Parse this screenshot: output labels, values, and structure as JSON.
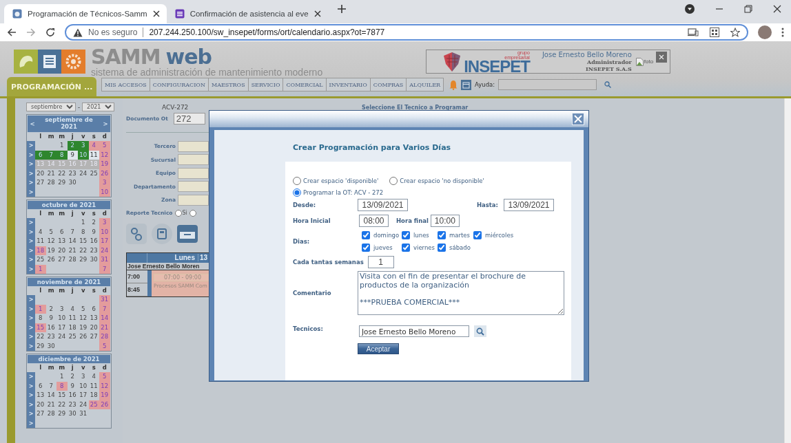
{
  "browser": {
    "tabs": [
      {
        "title": "Programación de Técnicos-Samm",
        "selected": true
      },
      {
        "title": "Confirmación de asistencia al eve",
        "selected": false
      }
    ],
    "security": "No es seguro",
    "url": "207.244.250.100/sw_insepet/forms/ort/calendario.aspx?ot=7877"
  },
  "header": {
    "brand_main": "SAMM",
    "brand_accent": "web",
    "tagline": "sistema de administración de mantenimiento moderno",
    "section_tab": "PROGRAMACIÓN ...",
    "menu": [
      "MIS ACCESOS",
      "CONFIGURACION",
      "MAESTROS",
      "SERVICIO",
      "COMERCIAL",
      "INVENTARIO",
      "COMPRAS",
      "ALQUILER"
    ],
    "help_label": "Ayuda:",
    "company": {
      "group_top": "grupo",
      "group_bottom": "empresarial",
      "name": "INSEPET"
    },
    "user": {
      "name": "Jose Ernesto Bello Moreno",
      "role": "Administrador",
      "company": "INSEPET S.A.S",
      "photo_alt": "foto"
    }
  },
  "calendar_panel": {
    "month_select": "septiembre",
    "separator": "-",
    "year_select": "2021",
    "months": [
      {
        "title": "septiembre de 2021",
        "prev": "<",
        "next": ">",
        "weekdays": [
          "l",
          "m",
          "m",
          "j",
          "v",
          "s",
          "d"
        ],
        "weeks": [
          {
            "arrow": ">",
            "days": [
              {
                "kind": "blank"
              },
              {
                "kind": "blank"
              },
              {
                "d": "1",
                "kind": "plain"
              },
              {
                "d": "2",
                "kind": "scheduled"
              },
              {
                "d": "3",
                "kind": "scheduled"
              },
              {
                "d": "4",
                "kind": "holiday"
              },
              {
                "d": "5",
                "kind": "holiday"
              }
            ]
          },
          {
            "arrow": ">",
            "days": [
              {
                "d": "6",
                "kind": "scheduled"
              },
              {
                "d": "7",
                "kind": "scheduled"
              },
              {
                "d": "8",
                "kind": "scheduled"
              },
              {
                "d": "9",
                "kind": "light"
              },
              {
                "d": "10",
                "kind": "scheduled"
              },
              {
                "d": "11",
                "kind": "light"
              },
              {
                "d": "12",
                "kind": "holiday"
              }
            ]
          },
          {
            "arrow": ">",
            "days": [
              {
                "d": "13",
                "kind": "week"
              },
              {
                "d": "14",
                "kind": "week"
              },
              {
                "d": "15",
                "kind": "week"
              },
              {
                "d": "16",
                "kind": "week"
              },
              {
                "d": "17",
                "kind": "week"
              },
              {
                "d": "18",
                "kind": "week"
              },
              {
                "d": "19",
                "kind": "holiday"
              }
            ]
          },
          {
            "arrow": ">",
            "days": [
              {
                "d": "20",
                "kind": "plain"
              },
              {
                "d": "21",
                "kind": "plain"
              },
              {
                "d": "22",
                "kind": "plain"
              },
              {
                "d": "23",
                "kind": "plain"
              },
              {
                "d": "24",
                "kind": "plain"
              },
              {
                "d": "25",
                "kind": "plain"
              },
              {
                "d": "26",
                "kind": "holiday"
              }
            ]
          },
          {
            "arrow": ">",
            "days": [
              {
                "d": "27",
                "kind": "plain"
              },
              {
                "d": "28",
                "kind": "plain"
              },
              {
                "d": "29",
                "kind": "plain"
              },
              {
                "d": "30",
                "kind": "plain"
              },
              {
                "kind": "blank"
              },
              {
                "kind": "blank"
              },
              {
                "d": "3",
                "kind": "holiday"
              }
            ]
          },
          {
            "arrow": ">",
            "days": [
              {
                "kind": "blank"
              },
              {
                "kind": "blank"
              },
              {
                "kind": "blank"
              },
              {
                "kind": "blank"
              },
              {
                "kind": "blank"
              },
              {
                "kind": "blank"
              },
              {
                "d": "10",
                "kind": "holiday"
              }
            ]
          }
        ]
      },
      {
        "title": "octubre de 2021",
        "weekdays": [
          "l",
          "m",
          "m",
          "j",
          "v",
          "s",
          "d"
        ],
        "weeks": [
          {
            "arrow": ">",
            "days": [
              {
                "kind": "blank"
              },
              {
                "kind": "blank"
              },
              {
                "kind": "blank"
              },
              {
                "kind": "blank"
              },
              {
                "d": "1",
                "kind": "plain"
              },
              {
                "d": "2",
                "kind": "plain"
              },
              {
                "d": "3",
                "kind": "holiday"
              }
            ]
          },
          {
            "arrow": ">",
            "days": [
              {
                "d": "4",
                "kind": "plain"
              },
              {
                "d": "5",
                "kind": "plain"
              },
              {
                "d": "6",
                "kind": "plain"
              },
              {
                "d": "7",
                "kind": "plain"
              },
              {
                "d": "8",
                "kind": "plain"
              },
              {
                "d": "9",
                "kind": "plain"
              },
              {
                "d": "10",
                "kind": "holiday"
              }
            ]
          },
          {
            "arrow": ">",
            "days": [
              {
                "d": "11",
                "kind": "plain"
              },
              {
                "d": "12",
                "kind": "plain"
              },
              {
                "d": "13",
                "kind": "plain"
              },
              {
                "d": "14",
                "kind": "plain"
              },
              {
                "d": "15",
                "kind": "plain"
              },
              {
                "d": "16",
                "kind": "plain"
              },
              {
                "d": "17",
                "kind": "holiday"
              }
            ]
          },
          {
            "arrow": ">",
            "days": [
              {
                "d": "18",
                "kind": "holiday"
              },
              {
                "d": "19",
                "kind": "plain"
              },
              {
                "d": "20",
                "kind": "plain"
              },
              {
                "d": "21",
                "kind": "plain"
              },
              {
                "d": "22",
                "kind": "plain"
              },
              {
                "d": "23",
                "kind": "plain"
              },
              {
                "d": "24",
                "kind": "holiday"
              }
            ]
          },
          {
            "arrow": ">",
            "days": [
              {
                "d": "25",
                "kind": "plain"
              },
              {
                "d": "26",
                "kind": "plain"
              },
              {
                "d": "27",
                "kind": "plain"
              },
              {
                "d": "28",
                "kind": "plain"
              },
              {
                "d": "29",
                "kind": "plain"
              },
              {
                "d": "30",
                "kind": "plain"
              },
              {
                "d": "31",
                "kind": "holiday"
              }
            ]
          },
          {
            "arrow": ">",
            "days": [
              {
                "d": "1",
                "kind": "holiday"
              },
              {
                "kind": "blank"
              },
              {
                "kind": "blank"
              },
              {
                "kind": "blank"
              },
              {
                "kind": "blank"
              },
              {
                "kind": "blank"
              },
              {
                "d": "7",
                "kind": "holiday"
              }
            ]
          }
        ]
      },
      {
        "title": "noviembre de 2021",
        "weekdays": [
          "l",
          "m",
          "m",
          "j",
          "v",
          "s",
          "d"
        ],
        "weeks": [
          {
            "arrow": ">",
            "days": [
              {
                "kind": "blank"
              },
              {
                "kind": "blank"
              },
              {
                "kind": "blank"
              },
              {
                "kind": "blank"
              },
              {
                "kind": "blank"
              },
              {
                "kind": "blank"
              },
              {
                "d": "31",
                "kind": "holiday"
              }
            ]
          },
          {
            "arrow": ">",
            "days": [
              {
                "d": "1",
                "kind": "holiday"
              },
              {
                "d": "2",
                "kind": "plain"
              },
              {
                "d": "3",
                "kind": "plain"
              },
              {
                "d": "4",
                "kind": "plain"
              },
              {
                "d": "5",
                "kind": "plain"
              },
              {
                "d": "6",
                "kind": "plain"
              },
              {
                "d": "7",
                "kind": "holiday"
              }
            ]
          },
          {
            "arrow": ">",
            "days": [
              {
                "d": "8",
                "kind": "plain"
              },
              {
                "d": "9",
                "kind": "plain"
              },
              {
                "d": "10",
                "kind": "plain"
              },
              {
                "d": "11",
                "kind": "plain"
              },
              {
                "d": "12",
                "kind": "plain"
              },
              {
                "d": "13",
                "kind": "plain"
              },
              {
                "d": "14",
                "kind": "holiday"
              }
            ]
          },
          {
            "arrow": ">",
            "days": [
              {
                "d": "15",
                "kind": "holiday"
              },
              {
                "d": "16",
                "kind": "plain"
              },
              {
                "d": "17",
                "kind": "plain"
              },
              {
                "d": "18",
                "kind": "plain"
              },
              {
                "d": "19",
                "kind": "plain"
              },
              {
                "d": "20",
                "kind": "plain"
              },
              {
                "d": "21",
                "kind": "holiday"
              }
            ]
          },
          {
            "arrow": ">",
            "days": [
              {
                "d": "22",
                "kind": "plain"
              },
              {
                "d": "23",
                "kind": "plain"
              },
              {
                "d": "24",
                "kind": "plain"
              },
              {
                "d": "25",
                "kind": "plain"
              },
              {
                "d": "26",
                "kind": "plain"
              },
              {
                "d": "27",
                "kind": "plain"
              },
              {
                "d": "28",
                "kind": "holiday"
              }
            ]
          },
          {
            "arrow": ">",
            "days": [
              {
                "d": "29",
                "kind": "plain"
              },
              {
                "d": "30",
                "kind": "plain"
              },
              {
                "kind": "blank"
              },
              {
                "kind": "blank"
              },
              {
                "kind": "blank"
              },
              {
                "kind": "blank"
              },
              {
                "d": "5",
                "kind": "holiday"
              }
            ]
          }
        ]
      },
      {
        "title": "diciembre de 2021",
        "weekdays": [
          "l",
          "m",
          "m",
          "j",
          "v",
          "s",
          "d"
        ],
        "weeks": [
          {
            "arrow": ">",
            "days": [
              {
                "kind": "blank"
              },
              {
                "kind": "blank"
              },
              {
                "d": "1",
                "kind": "plain"
              },
              {
                "d": "2",
                "kind": "plain"
              },
              {
                "d": "3",
                "kind": "plain"
              },
              {
                "d": "4",
                "kind": "plain"
              },
              {
                "d": "5",
                "kind": "holiday"
              }
            ]
          },
          {
            "arrow": ">",
            "days": [
              {
                "d": "6",
                "kind": "plain"
              },
              {
                "d": "7",
                "kind": "plain"
              },
              {
                "d": "8",
                "kind": "holiday"
              },
              {
                "d": "9",
                "kind": "plain"
              },
              {
                "d": "10",
                "kind": "plain"
              },
              {
                "d": "11",
                "kind": "plain"
              },
              {
                "d": "12",
                "kind": "holiday"
              }
            ]
          },
          {
            "arrow": ">",
            "days": [
              {
                "d": "13",
                "kind": "plain"
              },
              {
                "d": "14",
                "kind": "plain"
              },
              {
                "d": "15",
                "kind": "plain"
              },
              {
                "d": "16",
                "kind": "plain"
              },
              {
                "d": "17",
                "kind": "plain"
              },
              {
                "d": "18",
                "kind": "plain"
              },
              {
                "d": "19",
                "kind": "holiday"
              }
            ]
          },
          {
            "arrow": ">",
            "days": [
              {
                "d": "20",
                "kind": "plain"
              },
              {
                "d": "21",
                "kind": "plain"
              },
              {
                "d": "22",
                "kind": "plain"
              },
              {
                "d": "23",
                "kind": "plain"
              },
              {
                "d": "24",
                "kind": "plain"
              },
              {
                "d": "25",
                "kind": "holiday"
              },
              {
                "d": "26",
                "kind": "holiday"
              }
            ]
          },
          {
            "arrow": ">",
            "days": [
              {
                "d": "27",
                "kind": "plain"
              },
              {
                "d": "28",
                "kind": "plain"
              },
              {
                "d": "29",
                "kind": "plain"
              },
              {
                "d": "30",
                "kind": "plain"
              },
              {
                "d": "31",
                "kind": "plain"
              },
              {
                "kind": "blank"
              },
              {
                "kind": "blank"
              }
            ]
          },
          {
            "arrow": ">",
            "days": [
              {
                "kind": "blank"
              },
              {
                "kind": "blank"
              },
              {
                "kind": "blank"
              },
              {
                "kind": "blank"
              },
              {
                "kind": "blank"
              },
              {
                "kind": "blank"
              },
              {
                "kind": "blank"
              }
            ]
          }
        ]
      }
    ]
  },
  "work_order": {
    "code": "ACV-272",
    "doc_label": "Documento Ot",
    "doc_value": "272",
    "fields": [
      {
        "label": "Tercero"
      },
      {
        "label": "Sucursal"
      },
      {
        "label": "Equipo"
      },
      {
        "label": "Departamento"
      },
      {
        "label": "Zona"
      }
    ],
    "report_label": "Reporte Tecnico",
    "report_options": [
      {
        "label": "Si",
        "selected": false
      },
      {
        "selected": false
      }
    ],
    "schedule": {
      "day": "Lunes",
      "date": "13",
      "technician": "Jose Ernesto Bello Moren",
      "times": [
        "7:00",
        "8:45"
      ],
      "event_time": "07:00 - 09:00",
      "event_title": "Procesos SAMM Com"
    }
  },
  "select_title": "Seleccione El Tecnico a Programar",
  "modal": {
    "title": "Crear Programación para Varios Días",
    "modes": [
      {
        "label": "Crear espacio 'disponible'",
        "selected": false
      },
      {
        "label": "Crear espacio 'no disponible'",
        "selected": false
      },
      {
        "label": "Programar la OT: ACV - 272",
        "selected": true
      }
    ],
    "from_label": "Desde:",
    "from": "13/09/2021",
    "to_label": "Hasta:",
    "to": "13/09/2021",
    "start_label": "Hora Inicial",
    "start": "08:00",
    "end_label": "Hora final",
    "end": "10:00",
    "days_label": "Dias:",
    "days": [
      {
        "label": "domingo",
        "checked": true
      },
      {
        "label": "lunes",
        "checked": true
      },
      {
        "label": "martes",
        "checked": true
      },
      {
        "label": "miércoles",
        "checked": true
      },
      {
        "label": "jueves",
        "checked": true
      },
      {
        "label": "viernes",
        "checked": true
      },
      {
        "label": "sábado",
        "checked": true
      }
    ],
    "weeks_label": "Cada tantas semanas",
    "weeks": "1",
    "comment_label": "Comentario",
    "comment": "Visita con el fin de presentar el brochure de productos de la organización\n\n***PRUEBA COMERCIAL***",
    "tech_label": "Tecnicos:",
    "tech": "Jose Ernesto Bello Moreno",
    "submit": "Aceptar"
  }
}
